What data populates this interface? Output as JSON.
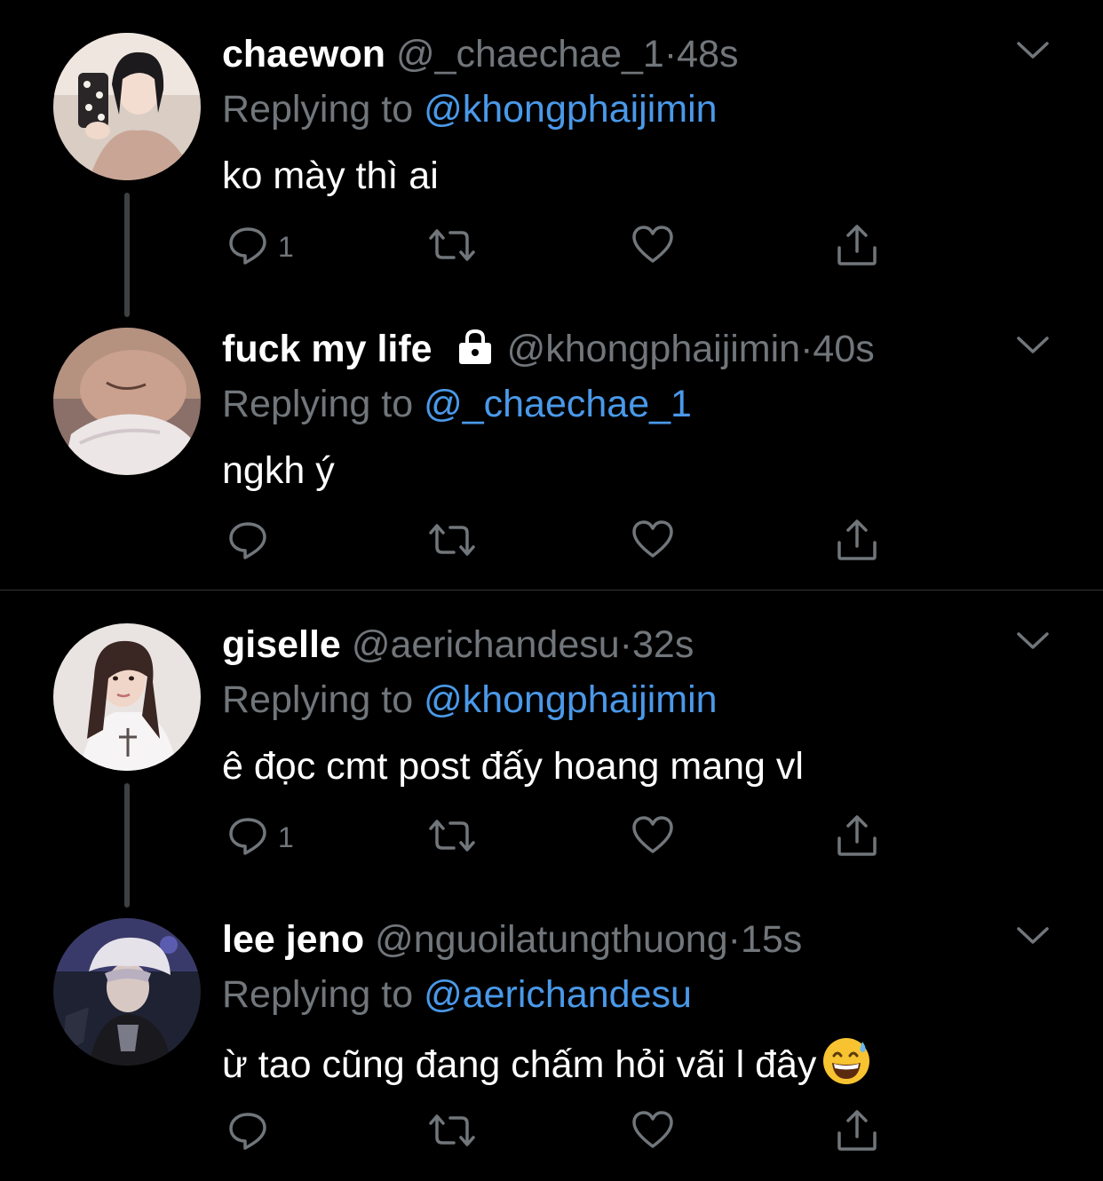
{
  "tweets": [
    {
      "display_name": "chaewon",
      "handle": "@_chaechae_1",
      "separator": "·",
      "time": "48s",
      "replying_prefix": "Replying to ",
      "replying_to": "@khongphaijimin",
      "text": "ko mày thì ai",
      "reply_count": "1"
    },
    {
      "display_name": "fuck my life",
      "handle": "@khongphaijimin",
      "separator": "·",
      "time": "40s",
      "replying_prefix": "Replying to ",
      "replying_to": "@_chaechae_1",
      "text": "ngkh ý",
      "reply_count": ""
    },
    {
      "display_name": "giselle",
      "handle": "@aerichandesu",
      "separator": "·",
      "time": "32s",
      "replying_prefix": "Replying to ",
      "replying_to": "@khongphaijimin",
      "text": "ê đọc cmt post đấy hoang mang vl",
      "reply_count": "1"
    },
    {
      "display_name": "lee jeno",
      "handle": "@nguoilatungthuong",
      "separator": "·",
      "time": "15s",
      "replying_prefix": "Replying to ",
      "replying_to": "@aerichandesu",
      "text": "ừ tao cũng đang chấm hỏi vãi l đây",
      "reply_count": ""
    }
  ],
  "icons": {
    "reply": "reply-icon",
    "retweet": "retweet-icon",
    "like": "heart-icon",
    "share": "share-icon",
    "more": "chevron-down-icon",
    "protected": "lock-icon",
    "emoji": "grinning-sweat-emoji-icon"
  },
  "colors": {
    "background": "#000000",
    "primary_text": "#ffffff",
    "secondary_text": "#71767b",
    "mention": "#4a99e9",
    "thread_line": "#3e4144",
    "divider": "#2f3336"
  }
}
